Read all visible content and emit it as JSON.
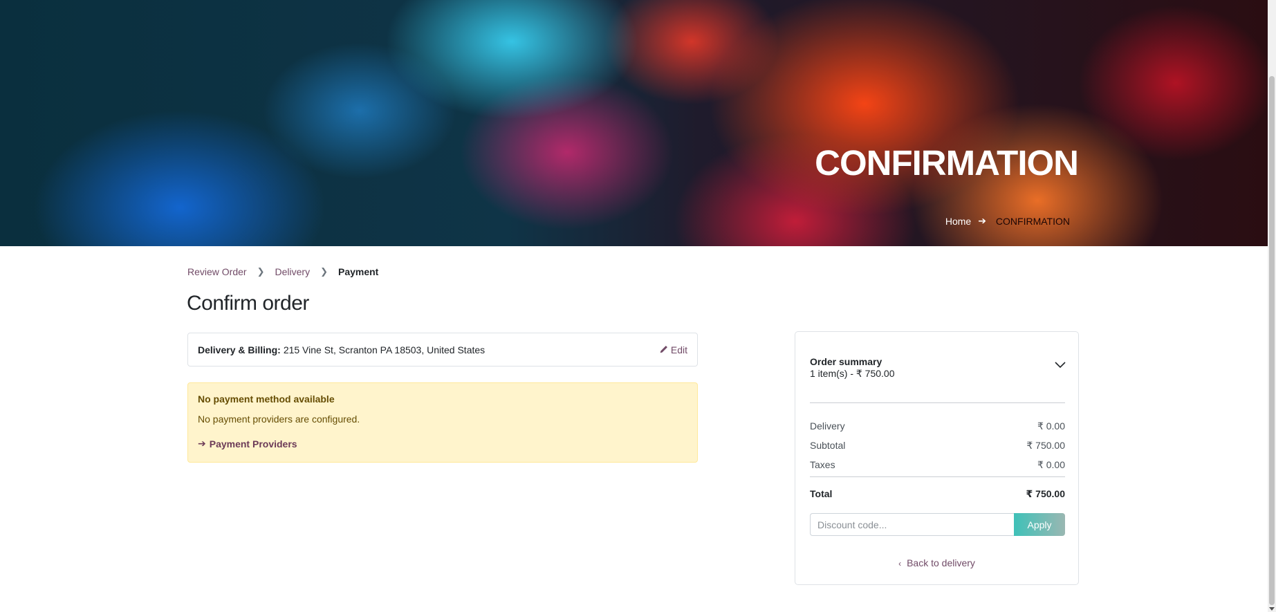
{
  "hero": {
    "title": "CONFIRMATION",
    "breadcrumb_home": "Home",
    "breadcrumb_current": "CONFIRMATION"
  },
  "wizard": {
    "steps": [
      "Review Order",
      "Delivery",
      "Payment"
    ],
    "active_step": "Payment"
  },
  "page_title": "Confirm order",
  "address": {
    "label": "Delivery & Billing:",
    "value": "215 Vine St, Scranton PA 18503, United States",
    "edit_label": "Edit"
  },
  "payment_warning": {
    "title": "No payment method available",
    "description": "No payment providers are configured.",
    "link_label": "Payment Providers"
  },
  "summary": {
    "title": "Order summary",
    "items_text": "1 item(s) -  ₹  750.00",
    "rows": [
      {
        "label": "Delivery",
        "value": "₹  0.00"
      },
      {
        "label": "Subtotal",
        "value": "₹  750.00"
      },
      {
        "label": "Taxes",
        "value": "₹  0.00"
      }
    ],
    "total_label": "Total",
    "total_value": "₹  750.00",
    "discount_placeholder": "Discount code...",
    "apply_label": "Apply",
    "back_label": "Back to delivery"
  },
  "colors": {
    "accent": "#714b67",
    "warning_bg": "#fff4cc",
    "warning_text": "#664d03",
    "apply_button": "#3fc1b8"
  }
}
